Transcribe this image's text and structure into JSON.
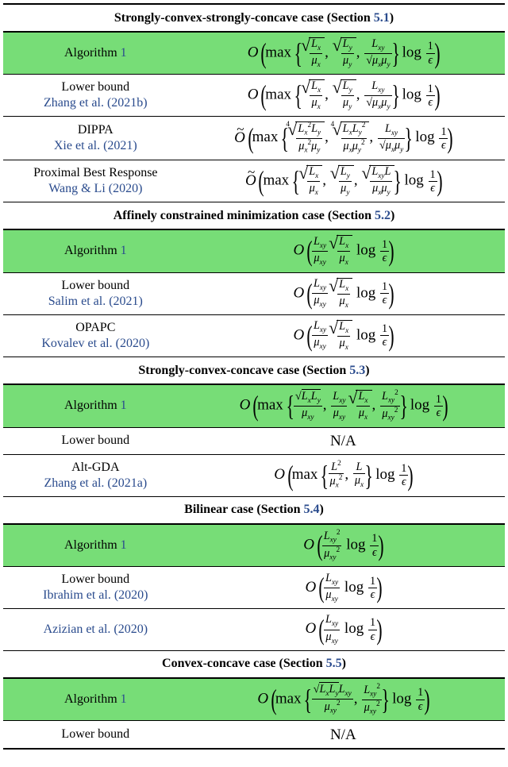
{
  "sections": {
    "s1": {
      "title_a": "Strongly-convex-strongly-concave case (Section ",
      "sec": "5.1",
      "title_b": ")"
    },
    "s2": {
      "title_a": "Affinely constrained minimization case (Section ",
      "sec": "5.2",
      "title_b": ")"
    },
    "s3": {
      "title_a": "Strongly-convex-concave case (Section ",
      "sec": "5.3",
      "title_b": ")"
    },
    "s4": {
      "title_a": "Bilinear case (Section ",
      "sec": "5.4",
      "title_b": ")"
    },
    "s5": {
      "title_a": "Convex-concave case (Section ",
      "sec": "5.5",
      "title_b": ")"
    }
  },
  "labels": {
    "alg1_a": "Algorithm ",
    "alg1_b": "1",
    "lower": "Lower bound",
    "na": "N/A",
    "dippa": "DIPPA",
    "pbr": "Proximal Best Response",
    "opapc": "OPAPC",
    "altgda": "Alt-GDA"
  },
  "cites": {
    "zhang_b": "Zhang et al. (2021b)",
    "xie": "Xie et al. (2021)",
    "wangli": "Wang & Li (2020)",
    "salim": "Salim et al. (2021)",
    "kovalev": "Kovalev et al. (2020)",
    "zhang_a": "Zhang et al. (2021a)",
    "ibrahim": "Ibrahim et al. (2020)",
    "azizian": "Azizian et al. (2020)"
  },
  "chart_data": {
    "type": "table",
    "title": "Complexity comparison across saddle-point problem settings",
    "sections": [
      {
        "name": "Strongly-convex-strongly-concave case (Section 5.1)",
        "rows": [
          {
            "method": "Algorithm 1",
            "highlighted": true,
            "complexity": "O( max{ sqrt(L_x/mu_x), sqrt(L_y/mu_y), L_xy/sqrt(mu_x mu_y) } log(1/eps) )"
          },
          {
            "method": "Lower bound",
            "cite": "Zhang et al. (2021b)",
            "complexity": "O( max{ sqrt(L_x/mu_x), sqrt(L_y/mu_y), L_xy/sqrt(mu_x mu_y) } log(1/eps) )"
          },
          {
            "method": "DIPPA",
            "cite": "Xie et al. (2021)",
            "complexity": "O~( max{ (L_x^2 L_y / (mu_x^2 mu_y))^{1/4}, (L_x L_y^2 / (mu_x mu_y^2))^{1/4}, L_xy/sqrt(mu_x mu_y) } log(1/eps) )"
          },
          {
            "method": "Proximal Best Response",
            "cite": "Wang & Li (2020)",
            "complexity": "O~( max{ sqrt(L_x/mu_x), sqrt(L_y/mu_y), sqrt(L_xy L / (mu_x mu_y)) } log(1/eps) )"
          }
        ]
      },
      {
        "name": "Affinely constrained minimization case (Section 5.2)",
        "rows": [
          {
            "method": "Algorithm 1",
            "highlighted": true,
            "complexity": "O( (L_xy/mu_xy) sqrt(L_x/mu_x) log(1/eps) )"
          },
          {
            "method": "Lower bound",
            "cite": "Salim et al. (2021)",
            "complexity": "O( (L_xy/mu_xy) sqrt(L_x/mu_x) log(1/eps) )"
          },
          {
            "method": "OPAPC",
            "cite": "Kovalev et al. (2020)",
            "complexity": "O( (L_xy/mu_xy) sqrt(L_x/mu_x) log(1/eps) )"
          }
        ]
      },
      {
        "name": "Strongly-convex-concave case (Section 5.3)",
        "rows": [
          {
            "method": "Algorithm 1",
            "highlighted": true,
            "complexity": "O( max{ sqrt(L_x L_y)/mu_xy, (L_xy/mu_xy) sqrt(L_x/mu_x), L_xy^2/mu_xy^2 } log(1/eps) )"
          },
          {
            "method": "Lower bound",
            "complexity": "N/A"
          },
          {
            "method": "Alt-GDA",
            "cite": "Zhang et al. (2021a)",
            "complexity": "O( max{ L^2/mu_x^2, L/mu_x } log(1/eps) )"
          }
        ]
      },
      {
        "name": "Bilinear case (Section 5.4)",
        "rows": [
          {
            "method": "Algorithm 1",
            "highlighted": true,
            "complexity": "O( (L_xy^2 / mu_xy^2) log(1/eps) )"
          },
          {
            "method": "Lower bound",
            "cite": "Ibrahim et al. (2020)",
            "complexity": "O( (L_xy / mu_xy) log(1/eps) )"
          },
          {
            "method": "",
            "cite": "Azizian et al. (2020)",
            "complexity": "O( (L_xy / mu_xy) log(1/eps) )"
          }
        ]
      },
      {
        "name": "Convex-concave case (Section 5.5)",
        "rows": [
          {
            "method": "Algorithm 1",
            "highlighted": true,
            "complexity": "O( max{ sqrt(L_x L_y) L_xy / mu_xy^2, L_xy^2 / mu_xy^2 } log(1/eps) )"
          },
          {
            "method": "Lower bound",
            "complexity": "N/A"
          }
        ]
      }
    ]
  }
}
